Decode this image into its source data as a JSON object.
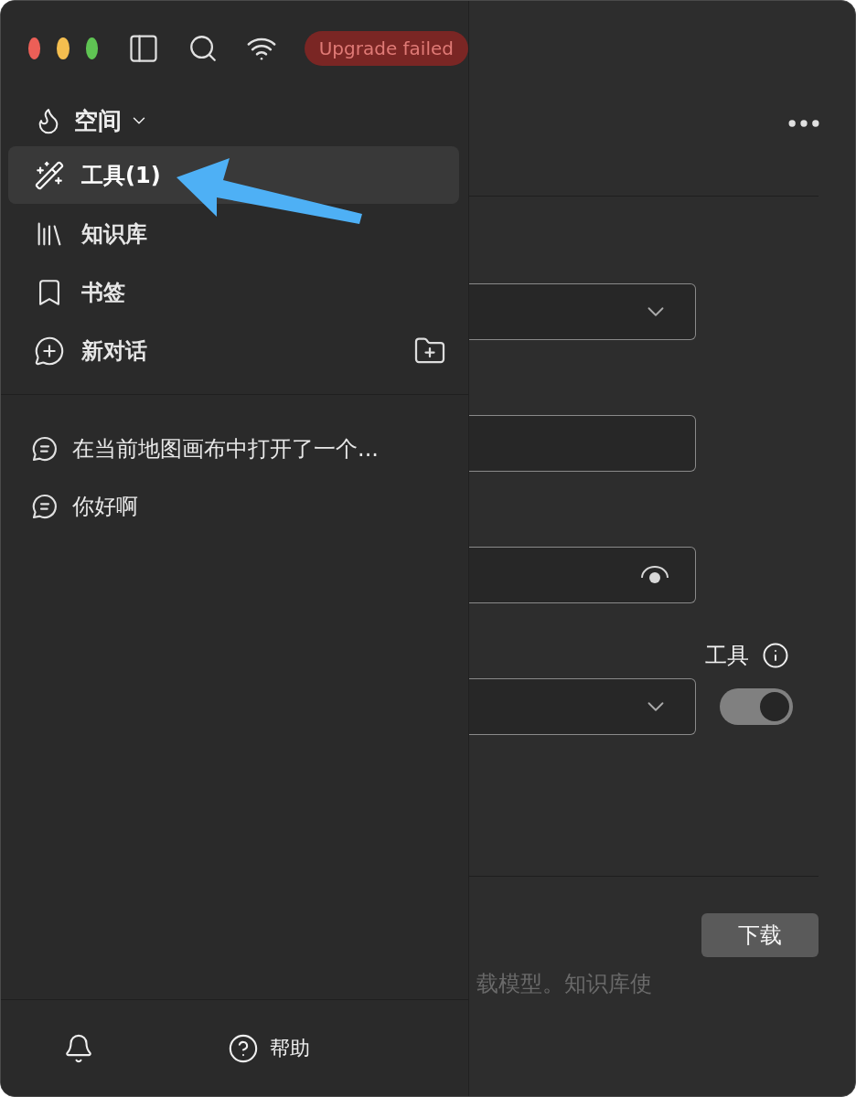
{
  "toolbar": {
    "badge": "Upgrade failed"
  },
  "sidebar": {
    "space": {
      "label": "空间"
    },
    "items": [
      {
        "kind": "tools",
        "label": "工具(1)",
        "selected": true
      },
      {
        "kind": "library",
        "label": "知识库",
        "selected": false
      },
      {
        "kind": "bookmarks",
        "label": "书签",
        "selected": false
      },
      {
        "kind": "new_chat",
        "label": "新对话",
        "selected": false
      }
    ],
    "conversations": [
      {
        "title": "在当前地图画布中打开了一个..."
      },
      {
        "title": "你好啊"
      }
    ],
    "footer": {
      "help": "帮助"
    }
  },
  "settings": {
    "fields": [
      {
        "kind": "select"
      },
      {
        "kind": "text"
      },
      {
        "kind": "password"
      },
      {
        "kind": "select"
      }
    ],
    "tools": {
      "label": "工具",
      "on": true
    },
    "embedding": {
      "button": "下载",
      "description_fragment": "载模型。知识库使"
    }
  }
}
